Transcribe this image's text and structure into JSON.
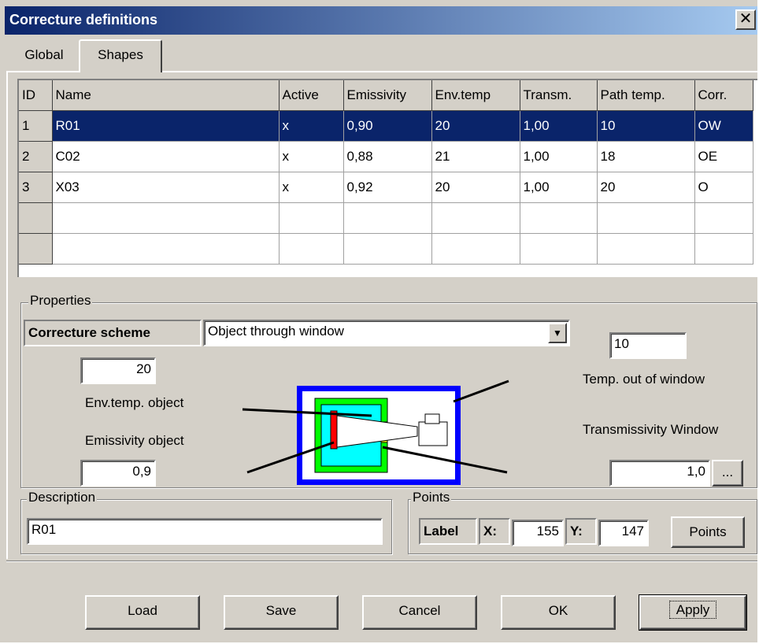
{
  "window": {
    "title": "Correcture definitions",
    "close_label": "✕"
  },
  "tabs": [
    {
      "label": "Global"
    },
    {
      "label": "Shapes"
    }
  ],
  "grid": {
    "headers": [
      "ID",
      "Name",
      "Active",
      "Emissivity",
      "Env.temp",
      "Transm.",
      "Path temp.",
      "Corr."
    ],
    "rows": [
      [
        "1",
        "R01",
        "x",
        "0,90",
        "20",
        "1,00",
        "10",
        "OW"
      ],
      [
        "2",
        "C02",
        "x",
        "0,88",
        "21",
        "1,00",
        "18",
        "OE"
      ],
      [
        "3",
        "X03",
        "x",
        "0,92",
        "20",
        "1,00",
        "20",
        "O"
      ]
    ]
  },
  "properties": {
    "group_label": "Properties",
    "scheme_label": "Correcture scheme",
    "scheme_value": "Object through window",
    "scheme_dropdown_icon": "triangle-down-icon",
    "env_temp_value": "20",
    "env_temp_label": "Env.temp. object",
    "emissivity_label": "Emissivity object",
    "emissivity_value": "0,9",
    "temp_out_value": "10",
    "temp_out_label": "Temp. out of window",
    "transmissivity_label": "Transmissivity Window",
    "transmissivity_value": "1,0",
    "browse_label": "..."
  },
  "description": {
    "group_label": "Description",
    "value": "R01"
  },
  "points": {
    "group_label": "Points",
    "label_text": "Label",
    "x_label": "X:",
    "x_value": "155",
    "y_label": "Y:",
    "y_value": "147",
    "button_label": "Points"
  },
  "buttons": {
    "load": "Load",
    "save": "Save",
    "cancel": "Cancel",
    "ok": "OK",
    "apply": "Apply"
  },
  "colors": {
    "selection": "#0a246a",
    "window_bg": "#d4d0c8",
    "diagram_outer": "#0000ff",
    "diagram_inner": "#00ff00",
    "diagram_core": "#00ffff",
    "diagram_object": "#ff0000",
    "diagram_window": "#ffff00"
  }
}
